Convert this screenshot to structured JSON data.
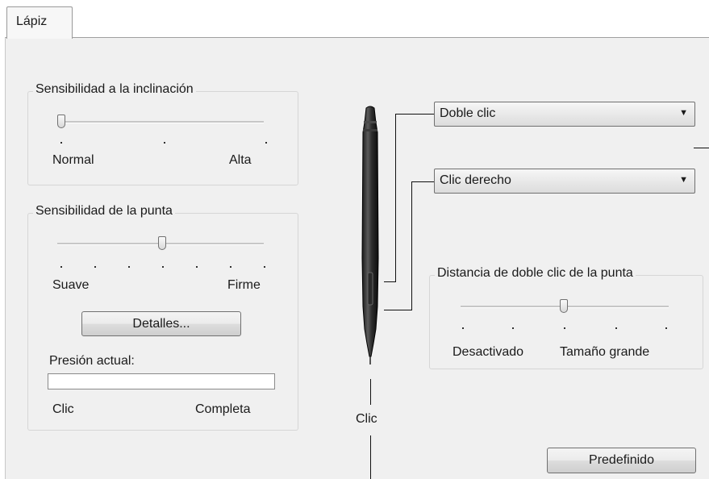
{
  "tab": {
    "label": "Lápiz"
  },
  "tilt": {
    "title": "Sensibilidad a la inclinación",
    "min_label": "Normal",
    "max_label": "Alta",
    "level": 0.0
  },
  "tip": {
    "title": "Sensibilidad de la punta",
    "min_label": "Suave",
    "max_label": "Firme",
    "level": 0.5,
    "details_button": "Detalles...",
    "pressure_label": "Presión actual:",
    "pressure_min": "Clic",
    "pressure_max": "Completa"
  },
  "pen": {
    "upper_button": {
      "value": "Doble clic"
    },
    "lower_button": {
      "value": "Clic derecho"
    },
    "tip_label": "Clic"
  },
  "double_click": {
    "title": "Distancia de doble clic de la punta",
    "min_label": "Desactivado",
    "max_label": "Tamaño grande",
    "level": 0.5
  },
  "default_button": "Predefinido"
}
